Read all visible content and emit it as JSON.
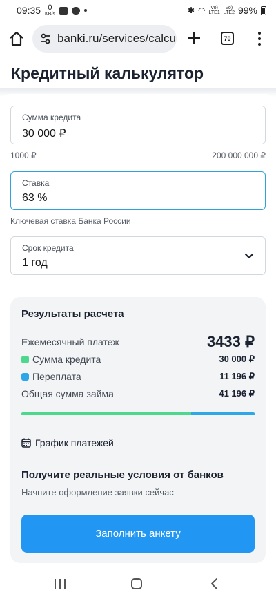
{
  "status_bar": {
    "time": "09:35",
    "net_speed_value": "0",
    "net_speed_unit": "KB/s",
    "sim1": "LTE1",
    "sim2": "LTE2",
    "battery": "99%"
  },
  "browser": {
    "url": "banki.ru/services/calcula",
    "tab_count": "70"
  },
  "page": {
    "title": "Кредитный калькулятор"
  },
  "form": {
    "amount": {
      "label": "Сумма кредита",
      "value": "30 000 ₽"
    },
    "amount_min": "1000 ₽",
    "amount_max": "200 000 000 ₽",
    "rate": {
      "label": "Ставка",
      "value": "63 %"
    },
    "rate_hint": "Ключевая ставка Банка России",
    "term": {
      "label": "Срок кредита",
      "value": "1 год"
    }
  },
  "results": {
    "title": "Результаты расчета",
    "monthly_label": "Ежемесячный платеж",
    "monthly_value": "3433 ₽",
    "principal_label": "Сумма кредита",
    "principal_value": "30 000 ₽",
    "overpay_label": "Переплата",
    "overpay_value": "11 196 ₽",
    "total_label": "Общая сумма займа",
    "total_value": "41 196 ₽",
    "principal_share": 0.728,
    "overpay_share": 0.272,
    "principal_color": "#4cd98e",
    "overpay_color": "#2ea7e8",
    "schedule_link": "График платежей",
    "promo_title": "Получите реальные условия от банков",
    "promo_subtitle": "Начните оформление заявки сейчас",
    "cta_label": "Заполнить анкету"
  }
}
